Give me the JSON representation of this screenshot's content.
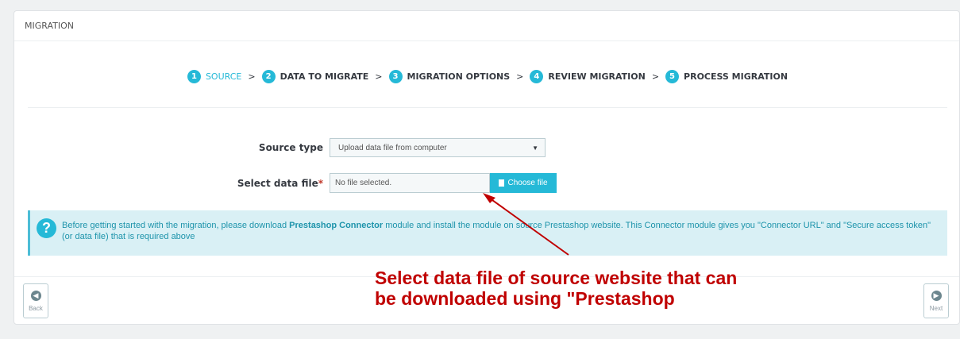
{
  "panel": {
    "title": "MIGRATION"
  },
  "steps": [
    {
      "num": "1",
      "label": "SOURCE",
      "active": true
    },
    {
      "num": "2",
      "label": "DATA TO MIGRATE"
    },
    {
      "num": "3",
      "label": "MIGRATION OPTIONS"
    },
    {
      "num": "4",
      "label": "REVIEW MIGRATION"
    },
    {
      "num": "5",
      "label": "PROCESS MIGRATION"
    }
  ],
  "step_separator": ">",
  "form": {
    "source_type_label": "Source type",
    "source_type_value": "Upload data file from computer",
    "data_file_label": "Select data file",
    "required_mark": "*",
    "data_file_value": "No file selected.",
    "choose_file_label": "Choose file"
  },
  "info": {
    "icon": "?",
    "text_before": "Before getting started with the migration, please download ",
    "link_text": "Prestashop Connector",
    "text_after": "  module and install the module on source Prestashop website. This Connector module gives you \"Connector URL\" and \"Secure access token\" (or data file) that is required above"
  },
  "nav": {
    "back_label": "Back",
    "next_label": "Next"
  },
  "annotation": {
    "line1": "Select data file of source website that can",
    "line2": "be downloaded using \"Prestashop"
  },
  "colors": {
    "accent": "#25b9d7",
    "annotation": "#c00000",
    "info_bg": "#d9f0f5"
  }
}
